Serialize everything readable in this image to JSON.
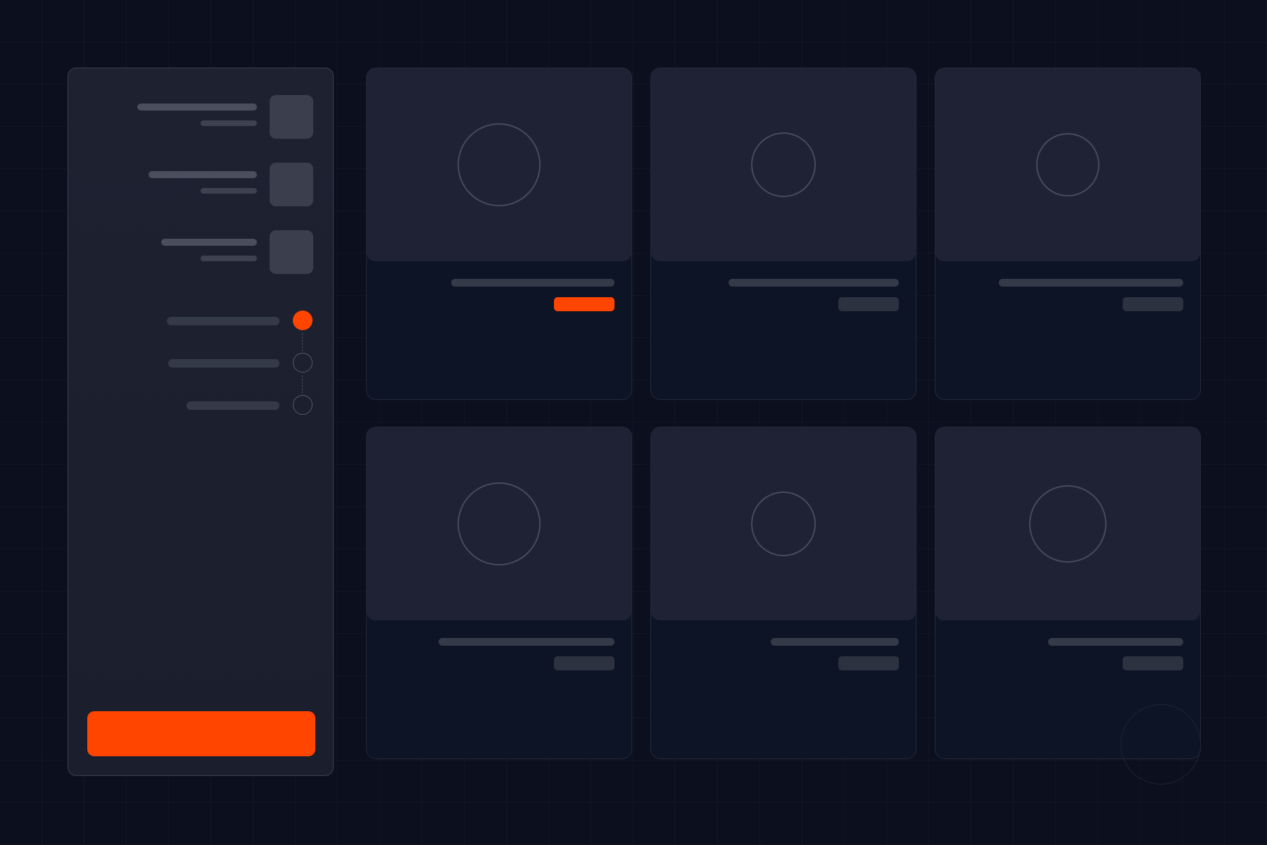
{
  "sidebar": {
    "profiles": [
      {
        "thumbnail_icon": "image-placeholder-icon"
      },
      {
        "thumbnail_icon": "image-placeholder-icon"
      },
      {
        "thumbnail_icon": "image-placeholder-icon"
      }
    ],
    "steps": [
      {
        "state": "active"
      },
      {
        "state": "inactive"
      },
      {
        "state": "inactive"
      }
    ],
    "cta_button": {
      "label": ""
    }
  },
  "cards": [
    {
      "image_icon": "circle-placeholder-icon",
      "price_pill": "highlighted"
    },
    {
      "image_icon": "circle-placeholder-icon",
      "price_pill": "default"
    },
    {
      "image_icon": "circle-placeholder-icon",
      "price_pill": "default"
    },
    {
      "image_icon": "circle-placeholder-icon",
      "price_pill": "default"
    },
    {
      "image_icon": "circle-placeholder-icon",
      "price_pill": "default"
    },
    {
      "image_icon": "circle-placeholder-icon",
      "price_pill": "default"
    }
  ],
  "colors": {
    "background": "#0b0f1e",
    "panel": "#1d2130",
    "card_media": "#1e2234",
    "card_body": "#0d1426",
    "accent": "#ff4500",
    "placeholder_line": "#353a48",
    "thumbnail": "#3b3f4d"
  }
}
